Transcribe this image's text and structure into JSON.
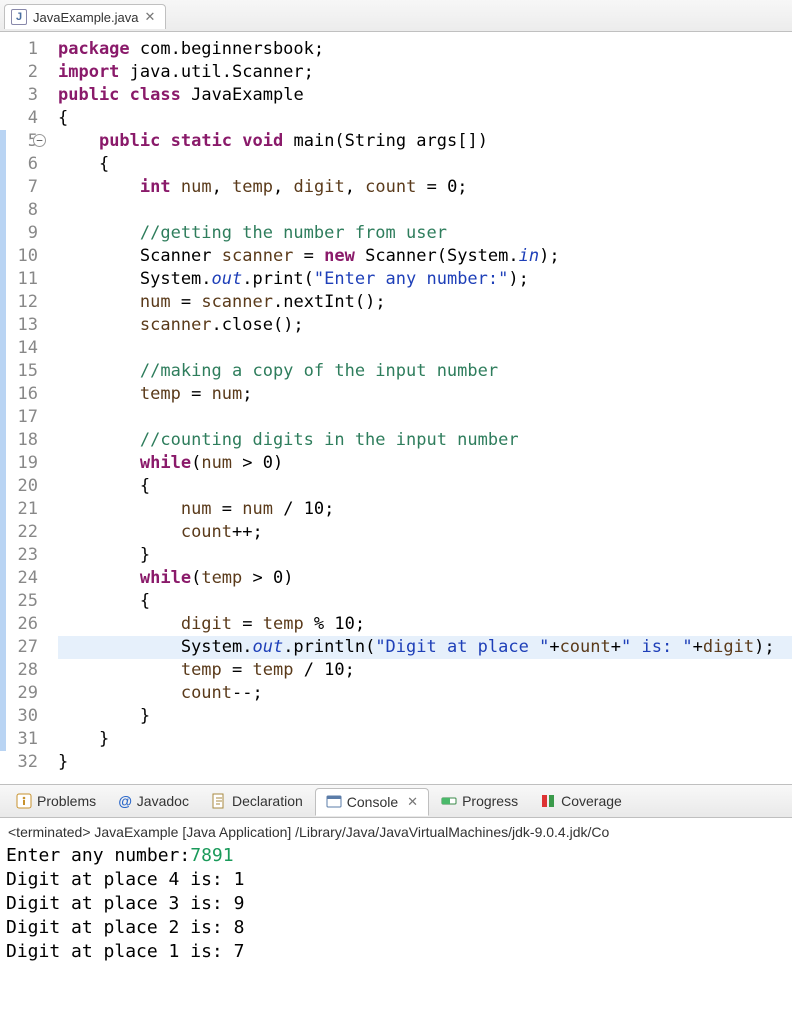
{
  "tab": {
    "filename": "JavaExample.java",
    "iconLetter": "J",
    "closeGlyph": "✕"
  },
  "code": {
    "lines": [
      {
        "n": 1,
        "html": "<span class='kw'>package</span> com.beginnersbook;"
      },
      {
        "n": 2,
        "html": "<span class='kw'>import</span> java.util.Scanner;"
      },
      {
        "n": 3,
        "html": "<span class='kw'>public</span> <span class='kw'>class</span> JavaExample"
      },
      {
        "n": 4,
        "html": "{"
      },
      {
        "n": 5,
        "html": "    <span class='kw'>public</span> <span class='kw'>static</span> <span class='kw'>void</span> main(String args[])",
        "fold": true
      },
      {
        "n": 6,
        "html": "    {"
      },
      {
        "n": 7,
        "html": "        <span class='kw'>int</span> <span class='var'>num</span>, <span class='var'>temp</span>, <span class='var'>digit</span>, <span class='var'>count</span> = 0;"
      },
      {
        "n": 8,
        "html": ""
      },
      {
        "n": 9,
        "html": "        <span class='com'>//getting the number from user</span>"
      },
      {
        "n": 10,
        "html": "        Scanner <span class='var'>scanner</span> = <span class='kw'>new</span> Scanner(System.<span class='field'>in</span>);"
      },
      {
        "n": 11,
        "html": "        System.<span class='field'>out</span>.print(<span class='str'>\"Enter any number:\"</span>);"
      },
      {
        "n": 12,
        "html": "        <span class='var'>num</span> = <span class='var'>scanner</span>.nextInt();"
      },
      {
        "n": 13,
        "html": "        <span class='var'>scanner</span>.close();"
      },
      {
        "n": 14,
        "html": ""
      },
      {
        "n": 15,
        "html": "        <span class='com'>//making a copy of the input number</span>"
      },
      {
        "n": 16,
        "html": "        <span class='var'>temp</span> = <span class='var'>num</span>;"
      },
      {
        "n": 17,
        "html": ""
      },
      {
        "n": 18,
        "html": "        <span class='com'>//counting digits in the input number</span>"
      },
      {
        "n": 19,
        "html": "        <span class='kw'>while</span>(<span class='var'>num</span> &gt; 0)"
      },
      {
        "n": 20,
        "html": "        {"
      },
      {
        "n": 21,
        "html": "            <span class='var'>num</span> = <span class='var'>num</span> / 10;"
      },
      {
        "n": 22,
        "html": "            <span class='var'>count</span>++;"
      },
      {
        "n": 23,
        "html": "        }"
      },
      {
        "n": 24,
        "html": "        <span class='kw'>while</span>(<span class='var'>temp</span> &gt; 0)"
      },
      {
        "n": 25,
        "html": "        {"
      },
      {
        "n": 26,
        "html": "            <span class='var'>digit</span> = <span class='var'>temp</span> % 10;"
      },
      {
        "n": 27,
        "html": "            System.<span class='field'>out</span>.println(<span class='str'>\"Digit at place \"</span>+<span class='var'>count</span>+<span class='str'>\" is: \"</span>+<span class='var'>digit</span>);",
        "highlight": true
      },
      {
        "n": 28,
        "html": "            <span class='var'>temp</span> = <span class='var'>temp</span> / 10;"
      },
      {
        "n": 29,
        "html": "            <span class='var'>count</span>--;"
      },
      {
        "n": 30,
        "html": "        }"
      },
      {
        "n": 31,
        "html": "    }"
      },
      {
        "n": 32,
        "html": "}"
      }
    ]
  },
  "bottomTabs": {
    "problems": "Problems",
    "javadoc": "Javadoc",
    "declaration": "Declaration",
    "console": "Console",
    "progress": "Progress",
    "coverage": "Coverage",
    "closeGlyph": "✕",
    "atGlyph": "@"
  },
  "console": {
    "header": "<terminated> JavaExample [Java Application] /Library/Java/JavaVirtualMachines/jdk-9.0.4.jdk/Co",
    "prompt": "Enter any number:",
    "input": "7891",
    "lines": [
      "Digit at place 4 is: 1",
      "Digit at place 3 is: 9",
      "Digit at place 2 is: 8",
      "Digit at place 1 is: 7"
    ]
  }
}
